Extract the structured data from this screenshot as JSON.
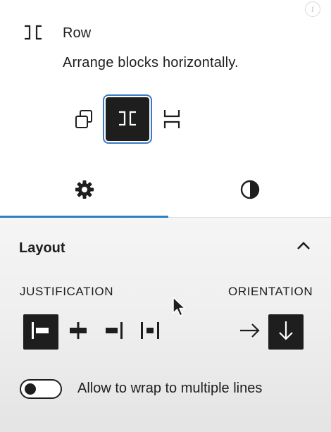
{
  "block": {
    "title": "Row",
    "description": "Arrange blocks horizontally.",
    "icon": "row-icon"
  },
  "variations": [
    {
      "name": "Group",
      "icon": "group-icon",
      "selected": false
    },
    {
      "name": "Row",
      "icon": "row-icon",
      "selected": true
    },
    {
      "name": "Stack",
      "icon": "stack-icon",
      "selected": false
    }
  ],
  "tabs": [
    {
      "name": "Settings",
      "icon": "gear-icon",
      "active": true
    },
    {
      "name": "Styles",
      "icon": "half-circle-icon",
      "active": false
    }
  ],
  "panel": {
    "title": "Layout",
    "expanded": true,
    "justification_label": "JUSTIFICATION",
    "orientation_label": "ORIENTATION",
    "justification_options": [
      {
        "name": "left",
        "icon": "justify-left-icon",
        "active": true
      },
      {
        "name": "center",
        "icon": "justify-center-icon",
        "active": false
      },
      {
        "name": "right",
        "icon": "justify-right-icon",
        "active": false
      },
      {
        "name": "space-between",
        "icon": "justify-space-between-icon",
        "active": false
      }
    ],
    "orientation_options": [
      {
        "name": "horizontal",
        "icon": "arrow-right-icon",
        "active": false
      },
      {
        "name": "vertical",
        "icon": "arrow-down-icon",
        "active": true
      }
    ],
    "wrap_label": "Allow to wrap to multiple lines",
    "wrap_enabled": false
  },
  "colors": {
    "accent": "#2c7fc1",
    "dark": "#1e1e1e"
  }
}
